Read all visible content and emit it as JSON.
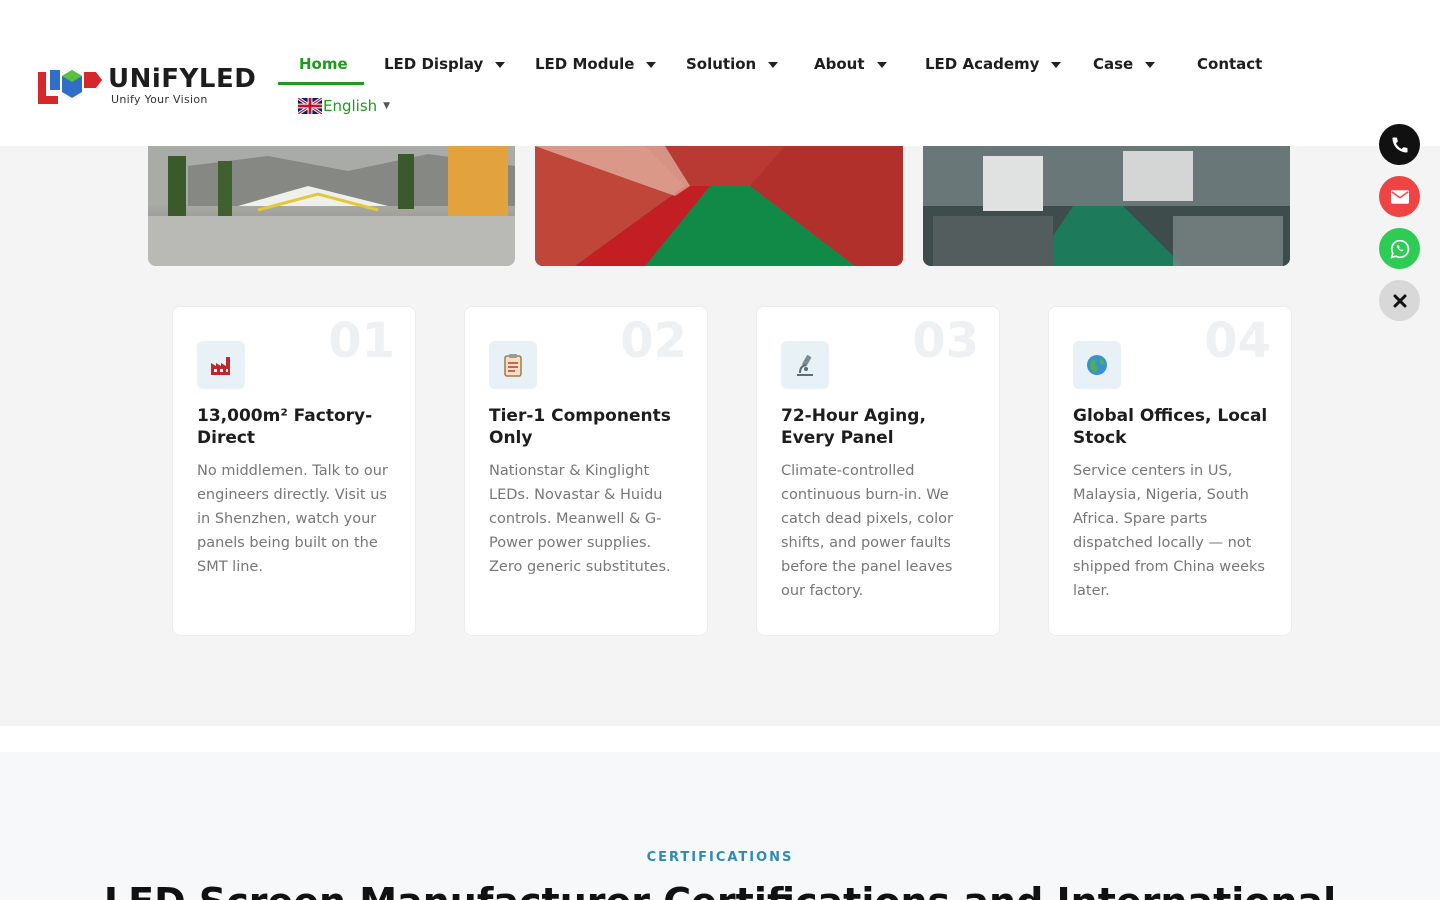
{
  "header": {
    "logo_text": "UNiFYLED",
    "logo_tagline": "Unify Your Vision",
    "nav": [
      {
        "label": "Home",
        "has_dropdown": false,
        "active": true
      },
      {
        "label": "LED Display",
        "has_dropdown": true
      },
      {
        "label": "LED Module",
        "has_dropdown": true
      },
      {
        "label": "Solution",
        "has_dropdown": true
      },
      {
        "label": "About",
        "has_dropdown": true
      },
      {
        "label": "LED Academy",
        "has_dropdown": true
      },
      {
        "label": "Case",
        "has_dropdown": true
      },
      {
        "label": "Contact",
        "has_dropdown": false
      }
    ],
    "language": "English",
    "language_flag": "uk-flag-icon"
  },
  "photos": [
    {
      "name": "showroom-photo"
    },
    {
      "name": "production-line-photo"
    },
    {
      "name": "smt-workshop-photo"
    }
  ],
  "features": [
    {
      "number": "01",
      "icon": "factory-icon",
      "title": "13,000m² Factory-Direct",
      "description": "No middlemen. Talk to our engineers directly. Visit us in Shenzhen, watch your panels being built on the SMT line."
    },
    {
      "number": "02",
      "icon": "clipboard-icon",
      "title": "Tier-1 Components Only",
      "description": "Nationstar & Kinglight LEDs. Novastar & Huidu controls. Meanwell & G-Power power supplies. Zero generic substitutes."
    },
    {
      "number": "03",
      "icon": "microscope-icon",
      "title": "72-Hour Aging, Every Panel",
      "description": "Climate-controlled continuous burn-in. We catch dead pixels, color shifts, and power faults before the panel leaves our factory."
    },
    {
      "number": "04",
      "icon": "globe-icon",
      "title": "Global Offices, Local Stock",
      "description": "Service centers in US, Malaysia, Nigeria, South Africa. Spare parts dispatched locally — not shipped from China weeks later."
    }
  ],
  "floating_buttons": [
    {
      "icon": "phone-icon"
    },
    {
      "icon": "mail-icon"
    },
    {
      "icon": "whatsapp-icon"
    },
    {
      "icon": "close-icon"
    }
  ],
  "certifications": {
    "label": "CERTIFICATIONS",
    "heading": "LED Screen Manufacturer Certifications and International"
  },
  "colors": {
    "accent_green": "#1f9a1f",
    "cert_blue": "#2f8bb0",
    "mail_red": "#f04444",
    "whatsapp_green": "#2ecc54"
  }
}
